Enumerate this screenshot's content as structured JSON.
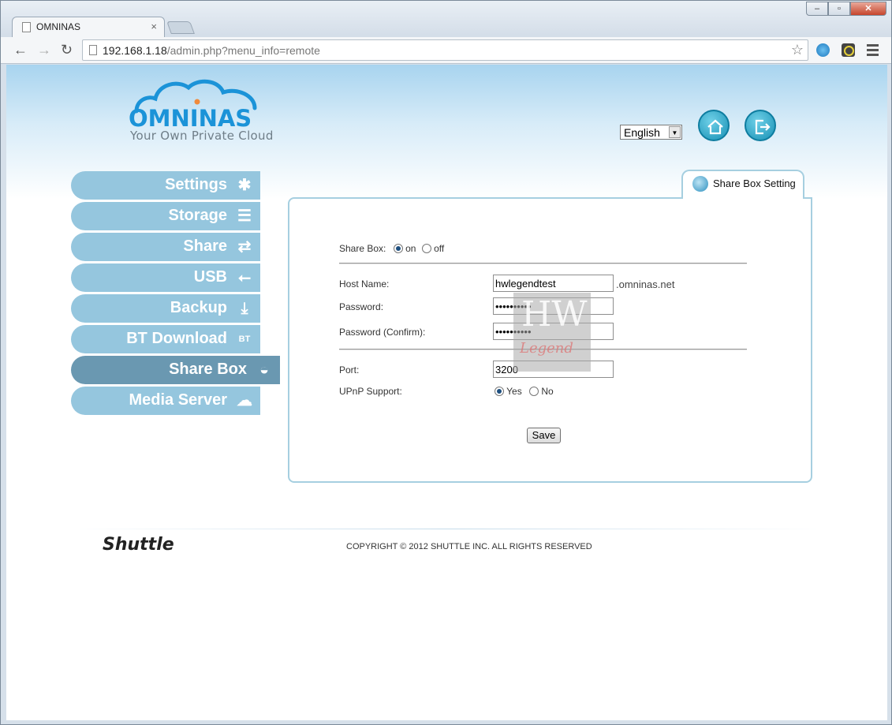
{
  "browser": {
    "tab_title": "OMNINAS",
    "url_host": "192.168.1.18",
    "url_path": "/admin.php?menu_info=remote"
  },
  "header": {
    "brand": "OMNINAS",
    "tagline": "Your Own Private Cloud",
    "language": "English"
  },
  "sidebar": {
    "items": [
      {
        "label": "Settings",
        "icon": "tools-icon"
      },
      {
        "label": "Storage",
        "icon": "storage-icon"
      },
      {
        "label": "Share",
        "icon": "share-arrows-icon"
      },
      {
        "label": "USB",
        "icon": "usb-icon"
      },
      {
        "label": "Backup",
        "icon": "backup-icon"
      },
      {
        "label": "BT Download",
        "icon": "bt-download-icon"
      },
      {
        "label": "Share Box",
        "icon": "share-box-icon",
        "active": true
      },
      {
        "label": "Media Server",
        "icon": "media-server-icon"
      }
    ]
  },
  "panel": {
    "tab_label": "Share Box Setting",
    "share_box_label": "Share Box:",
    "on_label": "on",
    "off_label": "off",
    "host_name_label": "Host Name:",
    "host_name_value": "hwlegendtest",
    "host_suffix": ".omninas.net",
    "password_label": "Password:",
    "password_value": "**********",
    "password_confirm_label": "Password (Confirm):",
    "password_confirm_value": "**********",
    "port_label": "Port:",
    "port_value": "3200",
    "upnp_label": "UPnP Support:",
    "yes_label": "Yes",
    "no_label": "No",
    "save_label": "Save"
  },
  "footer": {
    "logo": "Shuttle",
    "copyright": "COPYRIGHT © 2012 SHUTTLE INC. ALL RIGHTS RESERVED"
  },
  "watermark": {
    "text_top": "HW",
    "text_bottom": "Legend"
  },
  "colors": {
    "sidebar_item": "#95c6de",
    "sidebar_active": "#6a98b1",
    "brand_blue": "#1b93d8",
    "panel_border": "#a6cfe0"
  }
}
